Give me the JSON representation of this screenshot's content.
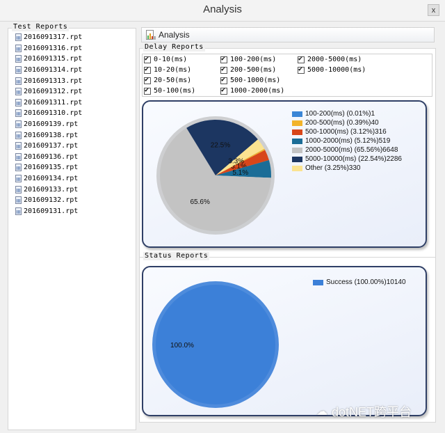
{
  "window": {
    "title": "Analysis",
    "close_label": "x"
  },
  "left_panel": {
    "title": "Test Reports",
    "items": [
      "2016091317.rpt",
      "2016091316.rpt",
      "2016091315.rpt",
      "2016091314.rpt",
      "2016091313.rpt",
      "2016091312.rpt",
      "2016091311.rpt",
      "2016091310.rpt",
      "201609139.rpt",
      "201609138.rpt",
      "201609137.rpt",
      "201609136.rpt",
      "201609135.rpt",
      "201609134.rpt",
      "201609133.rpt",
      "201609132.rpt",
      "201609131.rpt"
    ]
  },
  "tab": {
    "label": "Analysis"
  },
  "delay_group": {
    "title": "Delay  Reports",
    "checkboxes": [
      {
        "label": "0-10(ms)",
        "checked": true
      },
      {
        "label": "10-20(ms)",
        "checked": true
      },
      {
        "label": "20-50(ms)",
        "checked": true
      },
      {
        "label": "50-100(ms)",
        "checked": true
      },
      {
        "label": "100-200(ms)",
        "checked": true
      },
      {
        "label": "200-500(ms)",
        "checked": true
      },
      {
        "label": "500-1000(ms)",
        "checked": true
      },
      {
        "label": "1000-2000(ms)",
        "checked": true
      },
      {
        "label": "2000-5000(ms)",
        "checked": true
      },
      {
        "label": "5000-10000(ms)",
        "checked": true
      }
    ]
  },
  "status_group": {
    "title": "Status Reports"
  },
  "watermark": "dotNET跨平台",
  "chart_data": [
    {
      "type": "pie",
      "title": "",
      "legend_position": "right",
      "slices": [
        {
          "label": "100-200(ms) (0.01%)1",
          "value": 1,
          "color": "#3b86d6",
          "slice_label": ""
        },
        {
          "label": "200-500(ms) (0.39%)40",
          "value": 40,
          "color": "#f2b32a",
          "slice_label": "0.4%"
        },
        {
          "label": "500-1000(ms) (3.12%)316",
          "value": 316,
          "color": "#d8461a",
          "slice_label": "3.1%"
        },
        {
          "label": "1000-2000(ms) (5.12%)519",
          "value": 519,
          "color": "#1b6d97",
          "slice_label": "5.1%"
        },
        {
          "label": "2000-5000(ms) (65.56%)6648",
          "value": 6648,
          "color": "#c3c3c3",
          "slice_label": "65.6%"
        },
        {
          "label": "5000-10000(ms) (22.54%)2286",
          "value": 2286,
          "color": "#1c3661",
          "slice_label": "22.5%"
        },
        {
          "label": "Other (3.25%)330",
          "value": 330,
          "color": "#fbe390",
          "slice_label": "3.3%"
        }
      ]
    },
    {
      "type": "pie",
      "title": "",
      "legend_position": "top-right",
      "slices": [
        {
          "label": "Success (100.00%)10140",
          "value": 10140,
          "color": "#3c80d8",
          "slice_label": "100.0%"
        }
      ]
    }
  ]
}
